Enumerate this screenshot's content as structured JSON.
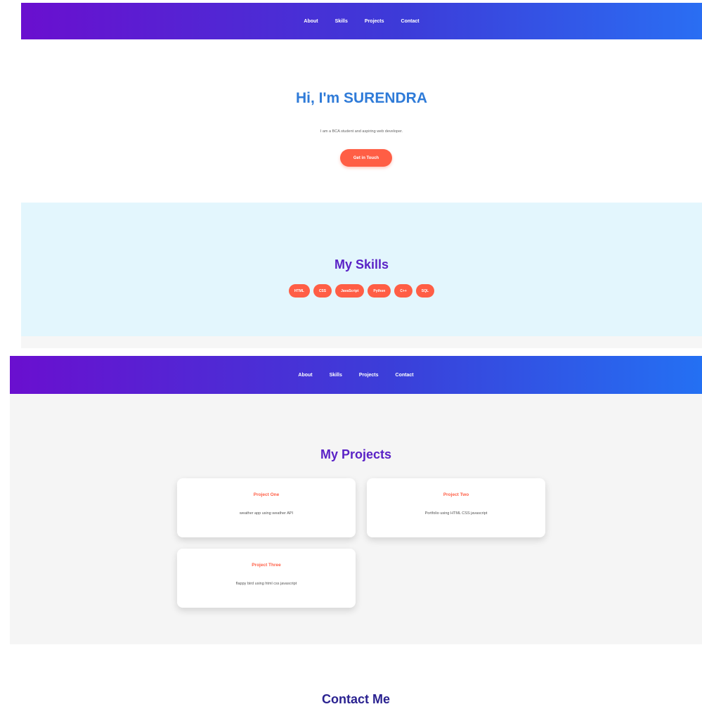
{
  "nav": {
    "items": [
      "About",
      "Skills",
      "Projects",
      "Contact"
    ]
  },
  "hero": {
    "title": "Hi, I'm SURENDRA",
    "subtitle": "I am a BCA student and aspiring web developer.",
    "cta_label": "Get in Touch"
  },
  "skills": {
    "title": "My Skills",
    "items": [
      "HTML",
      "CSS",
      "JavaScript",
      "Python",
      "C++",
      "SQL"
    ]
  },
  "projects": {
    "title": "My Projects",
    "items": [
      {
        "title": "Project One",
        "description": "weather app using weather API"
      },
      {
        "title": "Project Two",
        "description": "Portfolio using HTML CSS javascript"
      },
      {
        "title": "Project Three",
        "description": "flappy bird using html css javascript"
      }
    ]
  },
  "contact": {
    "title": "Contact Me"
  },
  "colors": {
    "nav_gradient_start": "#6a0fcf",
    "nav_gradient_end": "#2a6ef3",
    "accent": "#ff5e45",
    "heading_purple": "#5a22c6",
    "hero_blue": "#2f7bd8",
    "skills_bg": "#e3f6fd"
  }
}
